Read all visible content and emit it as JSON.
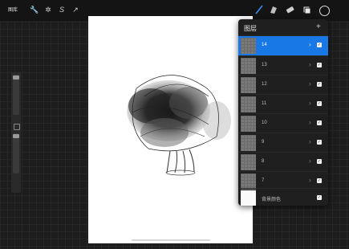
{
  "toolbar": {
    "gallery_label": "图库",
    "left_icons": [
      "wrench-icon",
      "magic-wand-icon",
      "selection-icon",
      "transform-arrow-icon"
    ],
    "left_glyphs": [
      "🔧",
      "✲",
      "S",
      "↗"
    ],
    "right_icons": [
      "brush-icon",
      "smudge-icon",
      "eraser-icon",
      "layers-icon"
    ],
    "active_tool": "brush",
    "current_color": "#111111"
  },
  "layers": {
    "title": "图层",
    "add_glyph": "+",
    "items": [
      {
        "name": "14",
        "active": true,
        "visible": true
      },
      {
        "name": "13",
        "active": false,
        "visible": true
      },
      {
        "name": "12",
        "active": false,
        "visible": true
      },
      {
        "name": "11",
        "active": false,
        "visible": true
      },
      {
        "name": "10",
        "active": false,
        "visible": true
      },
      {
        "name": "9",
        "active": false,
        "visible": true
      },
      {
        "name": "8",
        "active": false,
        "visible": true
      },
      {
        "name": "7",
        "active": false,
        "visible": true
      },
      {
        "name": "背景颜色",
        "active": false,
        "visible": true
      }
    ],
    "chevron_glyph": "›",
    "check_glyph": "✓",
    "accent_color": "#1878e6"
  },
  "sidebar": {
    "brush_size_level": 0.05,
    "opacity_level": 0.03
  }
}
